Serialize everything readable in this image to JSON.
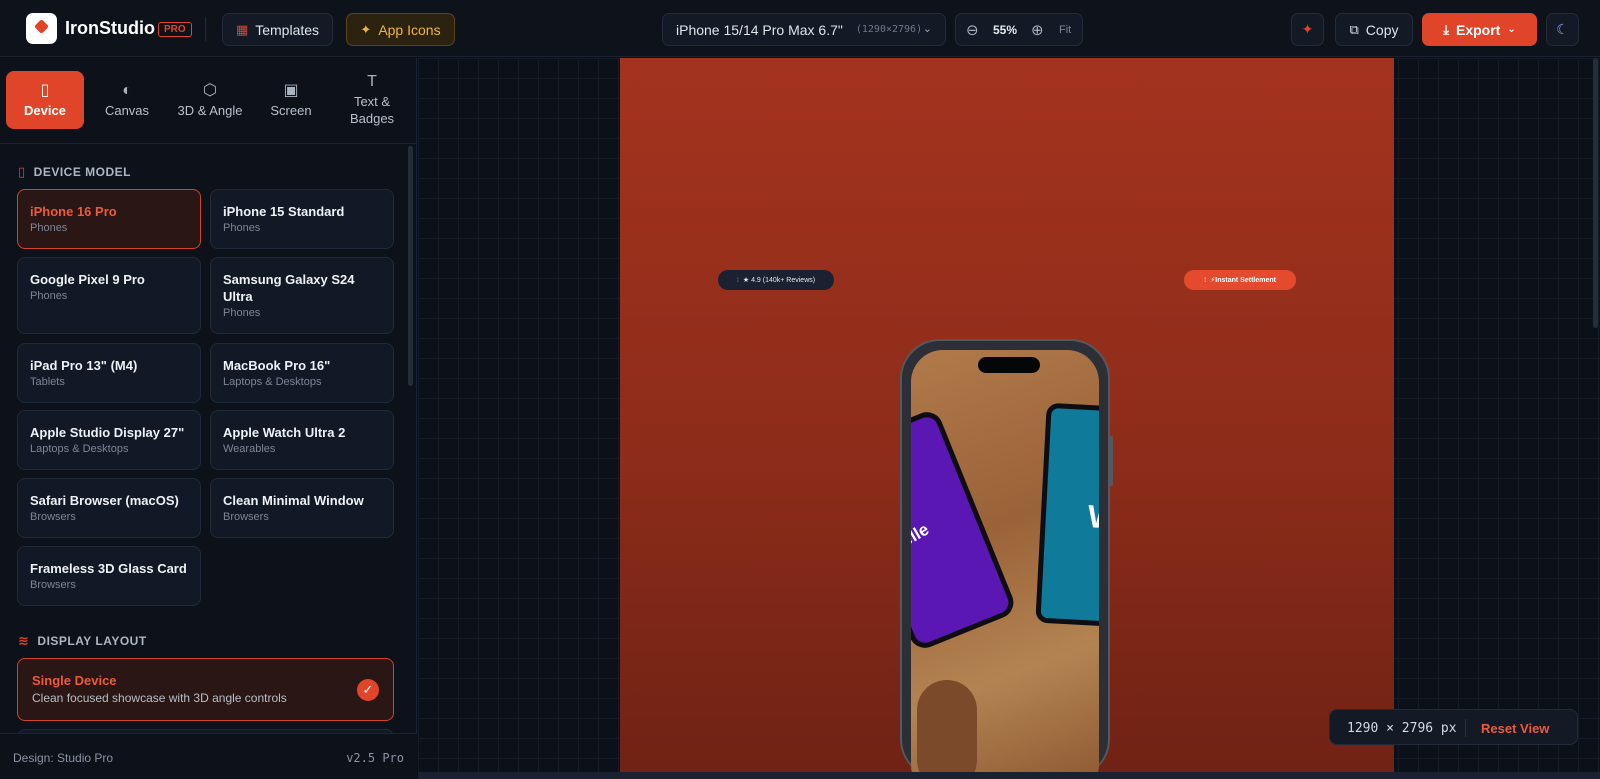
{
  "app": {
    "name_part1": "Iron",
    "name_part2": "Studio",
    "badge": "PRO"
  },
  "toolbar": {
    "templates_label": "Templates",
    "app_icons_label": "App Icons",
    "device_select": {
      "label": "iPhone 15/14 Pro Max 6.7\"",
      "resolution": "(1290×2796)"
    },
    "zoom": {
      "value": "55%",
      "fit_label": "Fit"
    },
    "copy_label": "Copy",
    "export_label": "Export"
  },
  "tabs": [
    {
      "label": "Device",
      "icon": "phone-icon",
      "active": true
    },
    {
      "label": "Canvas",
      "icon": "palette-icon",
      "active": false
    },
    {
      "label": "3D & Angle",
      "icon": "cube-icon",
      "active": false
    },
    {
      "label": "Screen",
      "icon": "image-icon",
      "active": false
    },
    {
      "label": "Text & Badges",
      "icon": "text-icon",
      "active": false
    }
  ],
  "device_model": {
    "title": "DEVICE MODEL",
    "items": [
      {
        "name": "iPhone 16 Pro",
        "category": "Phones",
        "selected": true
      },
      {
        "name": "iPhone 15 Standard",
        "category": "Phones"
      },
      {
        "name": "Google Pixel 9 Pro",
        "category": "Phones"
      },
      {
        "name": "Samsung Galaxy S24 Ultra",
        "category": "Phones"
      },
      {
        "name": "iPad Pro 13\" (M4)",
        "category": "Tablets"
      },
      {
        "name": "MacBook Pro 16\"",
        "category": "Laptops & Desktops"
      },
      {
        "name": "Apple Studio Display 27\"",
        "category": "Laptops & Desktops"
      },
      {
        "name": "Apple Watch Ultra 2",
        "category": "Wearables"
      },
      {
        "name": "Safari Browser (macOS)",
        "category": "Browsers"
      },
      {
        "name": "Clean Minimal Window",
        "category": "Browsers"
      },
      {
        "name": "Frameless 3D Glass Card",
        "category": "Browsers"
      }
    ]
  },
  "display_layout": {
    "title": "DISPLAY LAYOUT",
    "selected": {
      "name": "Single Device",
      "description": "Clean focused showcase with 3D angle controls"
    }
  },
  "footer": {
    "design": "Design: Studio Pro",
    "version": "v2.5 Pro"
  },
  "canvas": {
    "badge_left": "★ 4.9 (140k+ Reviews)",
    "badge_right": "⚡Instant Settlement",
    "screen_text_left": "elle",
    "screen_text_right": "W",
    "dimensions": "1290 × 2796 px",
    "reset_label": "Reset View"
  },
  "colors": {
    "accent": "#e0452a",
    "background": "#0b0f17",
    "artboard": "#9a301c",
    "app_icons": "#f2b53a"
  }
}
